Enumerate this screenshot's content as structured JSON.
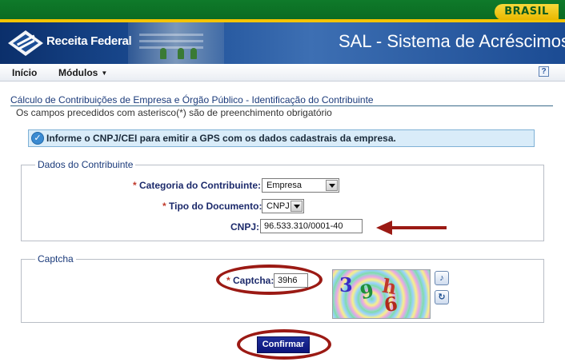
{
  "brasil_bar": {
    "label": "BRASIL"
  },
  "header": {
    "org": "Receita Federal",
    "title": "SAL - Sistema de Acréscimos L"
  },
  "menu": {
    "items": [
      "Início",
      "Módulos"
    ],
    "help": "?"
  },
  "page": {
    "title": "Cálculo de Contribuições de Empresa e Órgão Público - Identificação do Contribuinte",
    "subtitle": "Os campos precedidos com asterisco(*) são de preenchimento obrigatório"
  },
  "info": {
    "text": "Informe o CNPJ/CEI para emitir a GPS com os dados cadastrais da empresa."
  },
  "dados": {
    "legend": "Dados do Contribuinte",
    "categoria_label": "Categoria do Contribuinte:",
    "categoria_value": "Empresa",
    "tipo_label": "Tipo do Documento:",
    "tipo_value": "CNPJ",
    "cnpj_label": "CNPJ:",
    "cnpj_value": "96.533.310/0001-40"
  },
  "captcha": {
    "legend": "Captcha",
    "label": "Captcha:",
    "value": "39h6",
    "image_chars": [
      "3",
      "9",
      "h",
      "6"
    ]
  },
  "actions": {
    "confirm": "Confirmar"
  },
  "colors": {
    "annotation": "#9b1a14",
    "confirm_bg": "#0b147a",
    "header_blue": "#1c4e96"
  }
}
